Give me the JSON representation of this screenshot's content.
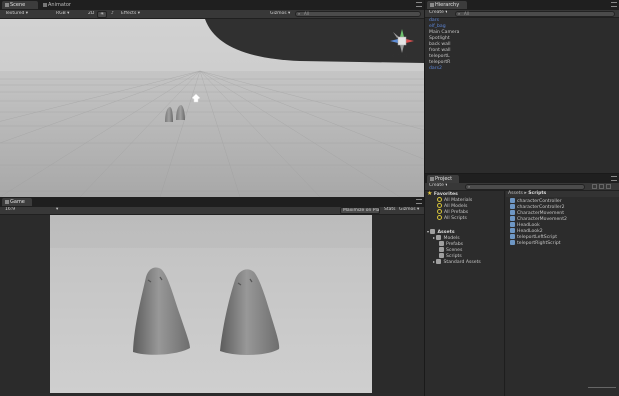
{
  "scene": {
    "tabs": [
      "Scene",
      "Animator"
    ],
    "shading_mode": "Textured",
    "render_mode": "RGB",
    "toggle_2d": "2D",
    "effects_label": "Effects",
    "gizmos_label": "Gizmos",
    "search_placeholder": "All",
    "gizmo_label": "< Persp"
  },
  "game": {
    "tab": "Game",
    "aspect": "16:9",
    "maximize_label": "Maximize on Play",
    "stats_label": "Stats",
    "gizmos_label": "Gizmos"
  },
  "hierarchy": {
    "tab": "Hierarchy",
    "create_label": "Create",
    "search_placeholder": "All",
    "items": [
      {
        "label": "dars",
        "selected": true
      },
      {
        "label": "elf_bag",
        "selected": true
      },
      {
        "label": "Main Camera",
        "selected": false
      },
      {
        "label": "Spotlight",
        "selected": false
      },
      {
        "label": "back wall",
        "selected": false
      },
      {
        "label": "front wall",
        "selected": false
      },
      {
        "label": "teleportL",
        "selected": false
      },
      {
        "label": "teleportR",
        "selected": false
      },
      {
        "label": "dars2",
        "selected": true
      }
    ]
  },
  "project": {
    "tab": "Project",
    "create_label": "Create",
    "favorites": {
      "label": "Favorites",
      "items": [
        "All Materials",
        "All Models",
        "All Prefabs",
        "All Scripts"
      ]
    },
    "assets": {
      "label": "Assets",
      "items": [
        "Models",
        "Prefabs",
        "Scenes",
        "Scripts",
        "Standard Assets"
      ]
    },
    "breadcrumb": [
      "Assets",
      "Scripts"
    ],
    "files": [
      "characterController",
      "characterController2",
      "CharacterMovement",
      "CharacterMovement2",
      "HeadLook",
      "HeadLook2",
      "teleportLeftScript",
      "teleportRightScript"
    ]
  },
  "colors": {
    "selected_text": "#5d86d6",
    "favorites_star": "#e6c83d",
    "folder": "#c7b27a",
    "script_icon": "#6e97c4"
  }
}
